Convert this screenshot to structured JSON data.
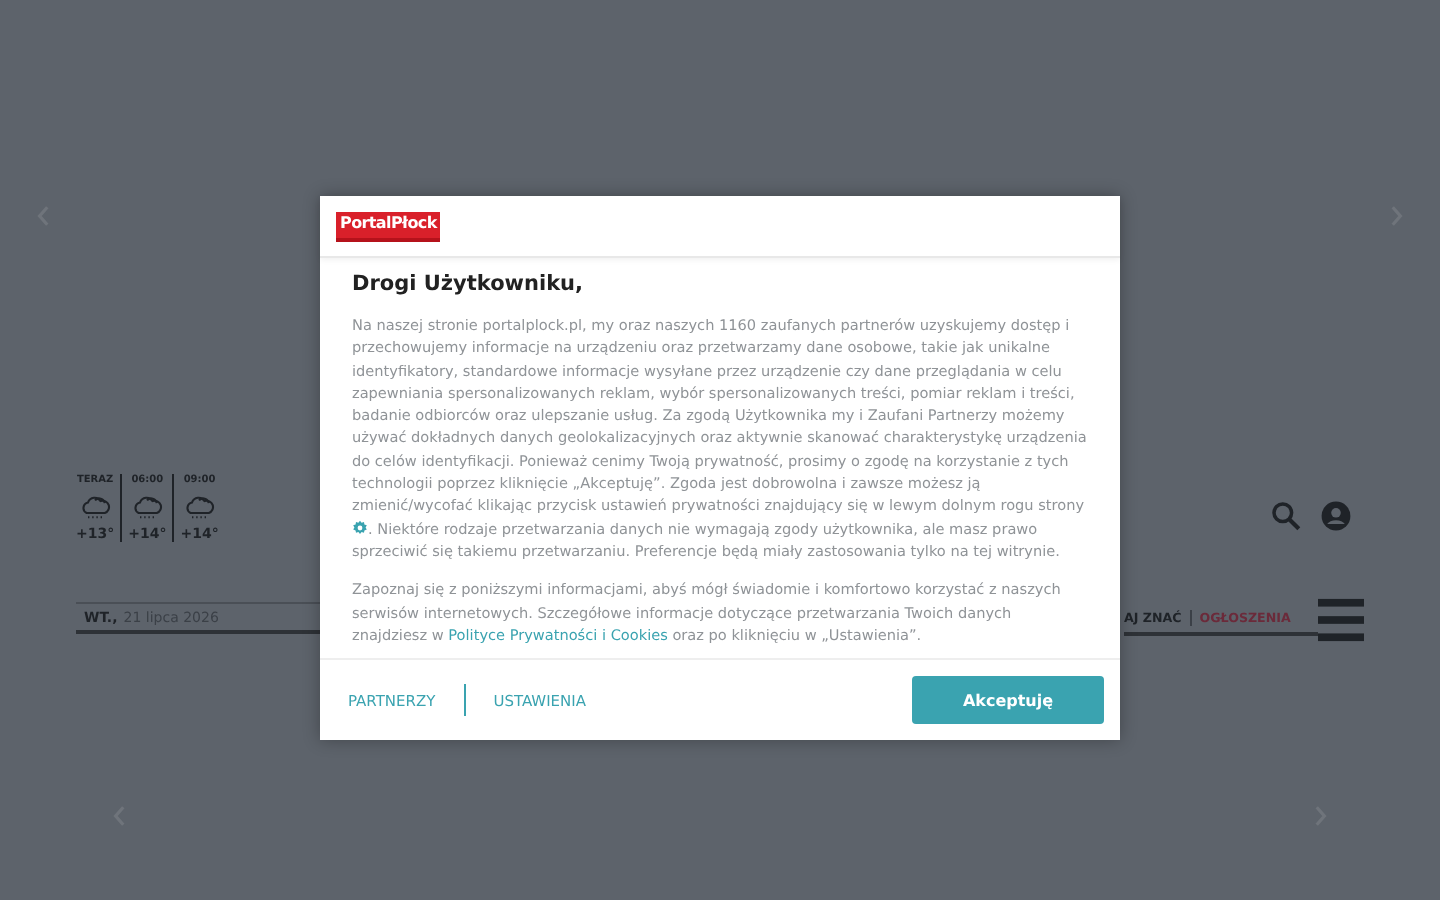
{
  "background_page": {
    "weather": [
      {
        "time": "TERAZ",
        "temp": "+13°"
      },
      {
        "time": "06:00",
        "temp": "+14°"
      },
      {
        "time": "09:00",
        "temp": "+14°"
      }
    ],
    "date": {
      "day": "WT.,",
      "date": "21 lipca 2026"
    },
    "nav_links": [
      {
        "label": "AJ ZNAĆ",
        "kind": "plain"
      },
      {
        "label": "OGŁOSZENIA",
        "kind": "highlight"
      }
    ]
  },
  "consent_dialog": {
    "logo": "PortalPłock",
    "title": "Drogi Użytkowniku,",
    "paragraph_1": {
      "text_before_icon": "Na naszej stronie portalplock.pl, my oraz naszych 1160 zaufanych partnerów uzyskujemy dostęp i przechowujemy informacje na urządzeniu oraz przetwarzamy dane osobowe, takie jak unikalne identyfikatory, standardowe informacje wysyłane przez urządzenie czy dane przeglądania w celu zapewniania spersonalizowanych reklam, wybór spersonalizowanych treści, pomiar reklam i treści, badanie odbiorców oraz ulepszanie usług. Za zgodą Użytkownika my i Zaufani Partnerzy możemy używać dokładnych danych geolokalizacyjnych oraz aktywnie skanować charakterystykę urządzenia do celów identyfikacji. Ponieważ cenimy Twoją prywatność, prosimy o zgodę na korzystanie z tych technologii poprzez kliknięcie „Akceptuję”. Zgoda jest dobrowolna i zawsze możesz ją zmienić/wycofać klikając przycisk ustawień prywatności znajdujący się w lewym dolnym rogu strony",
      "text_after_icon": ". Niektóre rodzaje przetwarzania danych nie wymagają zgody użytkownika, ale masz prawo sprzeciwić się takiemu przetwarzaniu. Preferencje będą miały zastosowania tylko na tej witrynie."
    },
    "paragraph_2": {
      "text_before_link": "Zapoznaj się z poniższymi informacjami, abyś mógł świadomie i komfortowo korzystać z naszych serwisów internetowych. Szczegółowe informacje dotyczące przetwarzania Twoich danych znajdziesz w ",
      "link": "Polityce Prywatności i Cookies",
      "text_after_link": " oraz po kliknięciu w „Ustawienia”."
    },
    "links": [
      "PARTNERZY",
      "USTAWIENIA"
    ],
    "accept_button": "Akceptuję"
  }
}
